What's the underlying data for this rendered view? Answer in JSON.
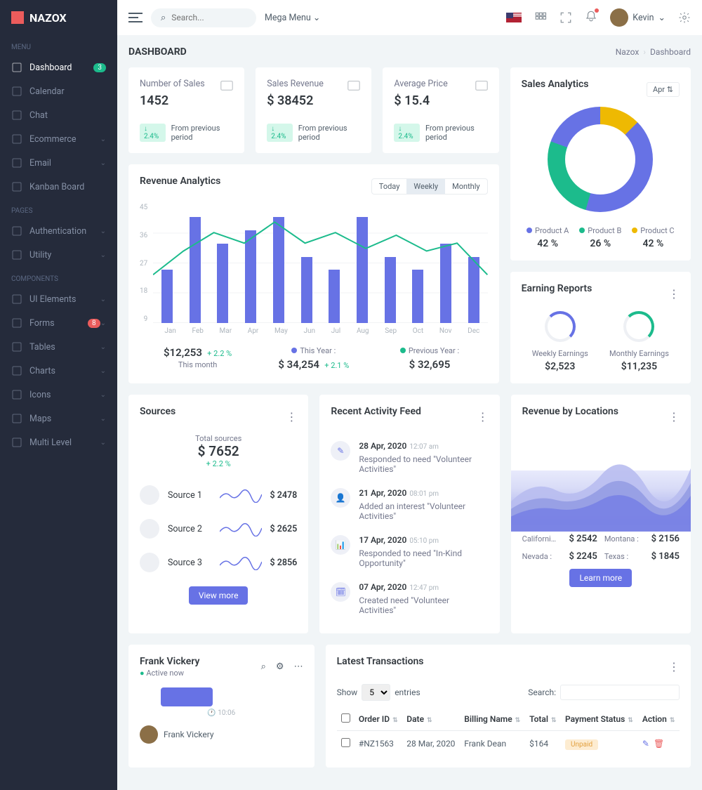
{
  "brand": "NAZOX",
  "search": {
    "placeholder": "Search..."
  },
  "mega_menu": "Mega Menu",
  "user": {
    "name": "Kevin"
  },
  "sidebar": {
    "sections": [
      {
        "title": "MENU",
        "items": [
          {
            "label": "Dashboard",
            "active": true,
            "badge": "3",
            "badgeColor": "green"
          },
          {
            "label": "Calendar"
          },
          {
            "label": "Chat"
          },
          {
            "label": "Ecommerce",
            "chev": true
          },
          {
            "label": "Email",
            "chev": true
          },
          {
            "label": "Kanban Board"
          }
        ]
      },
      {
        "title": "PAGES",
        "items": [
          {
            "label": "Authentication",
            "chev": true
          },
          {
            "label": "Utility",
            "chev": true
          }
        ]
      },
      {
        "title": "COMPONENTS",
        "items": [
          {
            "label": "UI Elements",
            "chev": true
          },
          {
            "label": "Forms",
            "chev": true,
            "badge": "8",
            "badgeColor": "red"
          },
          {
            "label": "Tables",
            "chev": true
          },
          {
            "label": "Charts",
            "chev": true
          },
          {
            "label": "Icons",
            "chev": true
          },
          {
            "label": "Maps",
            "chev": true
          },
          {
            "label": "Multi Level",
            "chev": true
          }
        ]
      }
    ]
  },
  "page": {
    "title": "DASHBOARD",
    "crumb1": "Nazox",
    "crumb2": "Dashboard"
  },
  "stats": [
    {
      "label": "Number of Sales",
      "value": "1452",
      "trend": "↓ 2.4%",
      "note": "From previous period"
    },
    {
      "label": "Sales Revenue",
      "value": "$ 38452",
      "trend": "↓ 2.4%",
      "note": "From previous period"
    },
    {
      "label": "Average Price",
      "value": "$ 15.4",
      "trend": "↓ 2.4%",
      "note": "From previous period"
    }
  ],
  "revenue": {
    "title": "Revenue Analytics",
    "tabs": [
      "Today",
      "Weekly",
      "Monthly"
    ],
    "active_tab": 1,
    "months": [
      "Jan",
      "Feb",
      "Mar",
      "Apr",
      "May",
      "Jun",
      "Jul",
      "Aug",
      "Sep",
      "Oct",
      "Nov",
      "Dec"
    ],
    "this_month_label": "This month",
    "this_month": "$12,253",
    "this_month_trend": "+ 2.2 %",
    "this_year_label": "This Year :",
    "this_year": "$ 34,254",
    "this_year_trend": "+ 2.1 %",
    "prev_year_label": "Previous Year :",
    "prev_year": "$ 32,695"
  },
  "analytics": {
    "title": "Sales Analytics",
    "period": "Apr",
    "legend": [
      {
        "name": "Product A",
        "val": "42 %",
        "color": "#6772e5"
      },
      {
        "name": "Product B",
        "val": "26 %",
        "color": "#1cbb8c"
      },
      {
        "name": "Product C",
        "val": "42 %",
        "color": "#eeb902"
      }
    ]
  },
  "earnings": {
    "title": "Earning Reports",
    "items": [
      {
        "label": "Weekly Earnings",
        "value": "$2,523"
      },
      {
        "label": "Monthly Earnings",
        "value": "$11,235"
      }
    ]
  },
  "sources_card": {
    "title": "Sources",
    "total_label": "Total sources",
    "total": "$ 7652",
    "trend": "+ 2.2 %",
    "items": [
      {
        "name": "Source 1",
        "value": "$ 2478"
      },
      {
        "name": "Source 2",
        "value": "$ 2625"
      },
      {
        "name": "Source 3",
        "value": "$ 2856"
      }
    ],
    "button": "View more"
  },
  "activity": {
    "title": "Recent Activity Feed",
    "items": [
      {
        "date": "28 Apr, 2020",
        "time": "12:07 am",
        "text": "Responded to need \"Volunteer Activities\""
      },
      {
        "date": "21 Apr, 2020",
        "time": "08:01 pm",
        "text": "Added an interest \"Volunteer Activities\""
      },
      {
        "date": "17 Apr, 2020",
        "time": "05:10 pm",
        "text": "Responded to need \"In-Kind Opportunity\""
      },
      {
        "date": "07 Apr, 2020",
        "time": "12:47 pm",
        "text": "Created need \"Volunteer Activities\""
      }
    ]
  },
  "locations": {
    "title": "Revenue by Locations",
    "button": "Learn more",
    "items": [
      {
        "name": "Californi…",
        "value": "$ 2542"
      },
      {
        "name": "Montana :",
        "value": "$ 2156"
      },
      {
        "name": "Nevada :",
        "value": "$ 2245"
      },
      {
        "name": "Texas :",
        "value": "$ 1845"
      }
    ]
  },
  "chat": {
    "name": "Frank Vickery",
    "status": "Active now",
    "time": "10:06",
    "user": "Frank Vickery"
  },
  "transactions": {
    "title": "Latest Transactions",
    "show": "Show",
    "entries": "entries",
    "page_size": "5",
    "search": "Search:",
    "cols": [
      "Order ID",
      "Date",
      "Billing Name",
      "Total",
      "Payment Status",
      "Action"
    ],
    "rows": [
      {
        "id": "#NZ1563",
        "date": "28 Mar, 2020",
        "name": "Frank Dean",
        "total": "$164",
        "status": "Unpaid"
      }
    ]
  },
  "chart_data": {
    "revenue_analytics": {
      "type": "bar+line",
      "y_ticks": [
        45,
        36,
        27,
        18,
        9
      ],
      "categories": [
        "Jan",
        "Feb",
        "Mar",
        "Apr",
        "May",
        "Jun",
        "Jul",
        "Aug",
        "Sep",
        "Oct",
        "Nov",
        "Dec"
      ],
      "bars": [
        20,
        40,
        30,
        35,
        40,
        25,
        20,
        40,
        25,
        20,
        30,
        25
      ],
      "line": [
        18,
        27,
        34,
        30,
        38,
        30,
        34,
        28,
        33,
        27,
        30,
        18
      ]
    },
    "sales_donut": {
      "type": "pie",
      "series": [
        {
          "name": "Product A",
          "value": 42
        },
        {
          "name": "Product B",
          "value": 26
        },
        {
          "name": "Product C",
          "value": 42
        }
      ]
    },
    "locations_area": {
      "type": "area",
      "series": [
        {
          "name": "s1",
          "values": [
            30,
            40,
            35,
            60,
            45,
            70,
            50,
            75
          ]
        },
        {
          "name": "s2",
          "values": [
            20,
            30,
            25,
            45,
            35,
            55,
            40,
            60
          ]
        },
        {
          "name": "s3",
          "values": [
            10,
            20,
            15,
            30,
            25,
            40,
            30,
            45
          ]
        }
      ]
    }
  }
}
